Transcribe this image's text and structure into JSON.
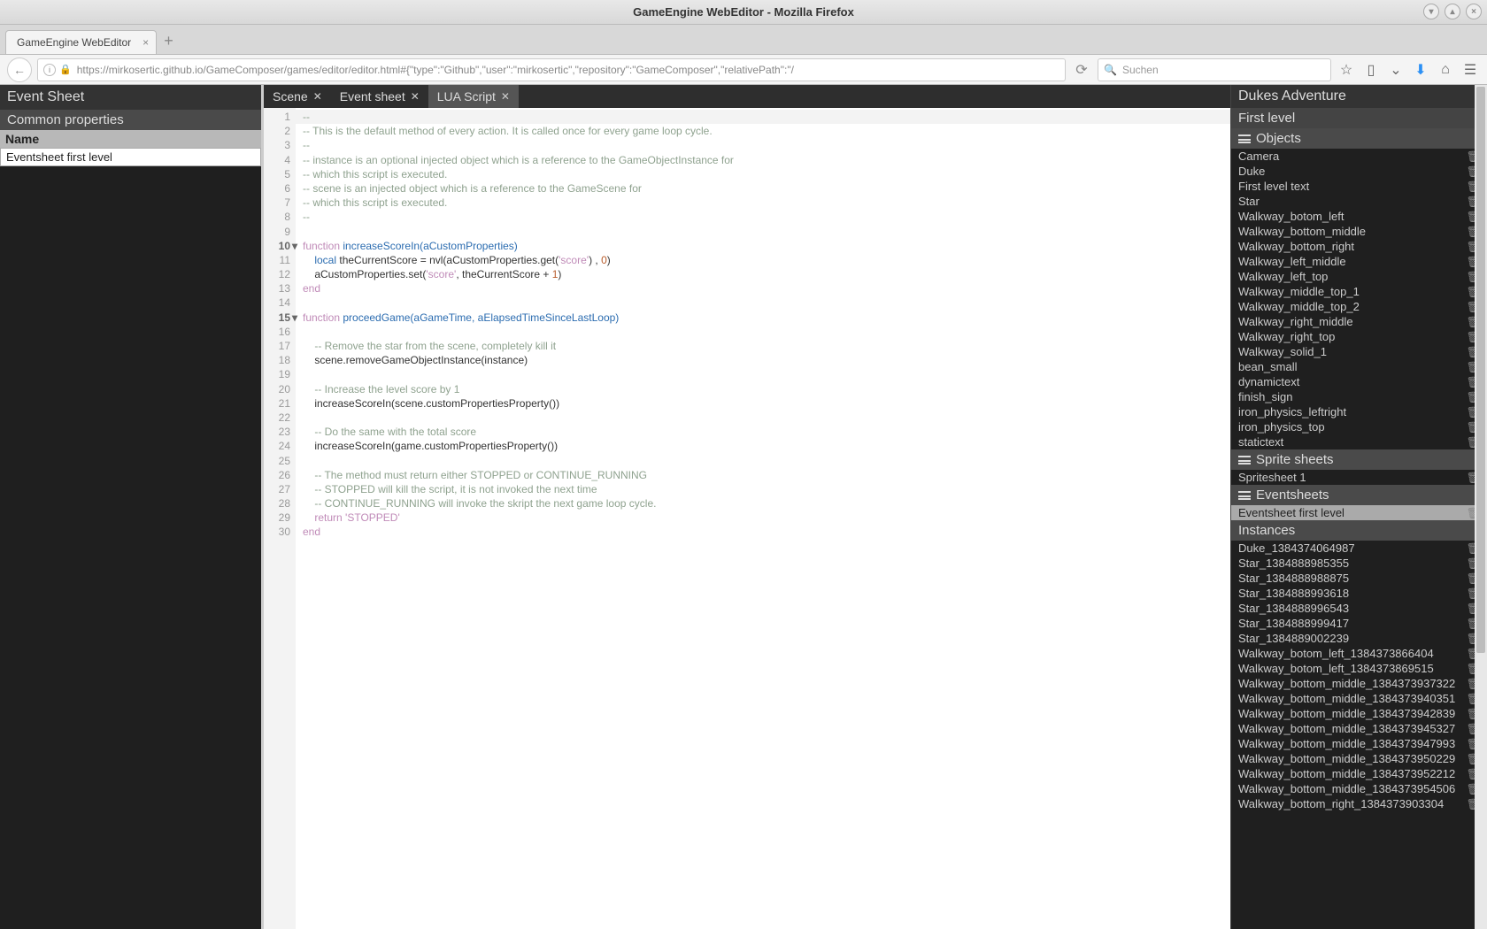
{
  "window": {
    "title": "GameEngine WebEditor - Mozilla Firefox"
  },
  "browser": {
    "tab": "GameEngine WebEditor",
    "url": "https://mirkosertic.github.io/GameComposer/games/editor/editor.html#{\"type\":\"Github\",\"user\":\"mirkosertic\",\"repository\":\"GameComposer\",\"relativePath\":\"/",
    "searchPlaceholder": "Suchen"
  },
  "left": {
    "title": "Event Sheet",
    "section": "Common properties",
    "propLabel": "Name",
    "propValue": "Eventsheet first level"
  },
  "tabs": [
    {
      "label": "Scene",
      "closable": true,
      "active": false
    },
    {
      "label": "Event sheet",
      "closable": true,
      "active": false
    },
    {
      "label": "LUA Script",
      "closable": true,
      "active": true
    }
  ],
  "code": [
    {
      "n": 1,
      "hl": true,
      "seg": [
        {
          "t": "--",
          "c": "c-comment"
        }
      ]
    },
    {
      "n": 2,
      "seg": [
        {
          "t": "-- This is the default method of every action. It is called once for every game loop cycle.",
          "c": "c-comment"
        }
      ]
    },
    {
      "n": 3,
      "seg": [
        {
          "t": "--",
          "c": "c-comment"
        }
      ]
    },
    {
      "n": 4,
      "seg": [
        {
          "t": "-- instance is an optional injected object which is a reference to the GameObjectInstance for",
          "c": "c-comment"
        }
      ]
    },
    {
      "n": 5,
      "seg": [
        {
          "t": "-- which this script is executed.",
          "c": "c-comment"
        }
      ]
    },
    {
      "n": 6,
      "seg": [
        {
          "t": "-- scene is an injected object which is a reference to the GameScene for",
          "c": "c-comment"
        }
      ]
    },
    {
      "n": 7,
      "seg": [
        {
          "t": "-- which this script is executed.",
          "c": "c-comment"
        }
      ]
    },
    {
      "n": 8,
      "seg": [
        {
          "t": "--",
          "c": "c-comment"
        }
      ]
    },
    {
      "n": 9,
      "seg": [
        {
          "t": "",
          "c": ""
        }
      ]
    },
    {
      "n": 10,
      "break": true,
      "seg": [
        {
          "t": "function",
          "c": "c-kw"
        },
        {
          "t": " increaseScoreIn(aCustomProperties)",
          "c": "c-fn"
        }
      ]
    },
    {
      "n": 11,
      "seg": [
        {
          "t": "    ",
          "c": ""
        },
        {
          "t": "local",
          "c": "c-local"
        },
        {
          "t": " theCurrentScore = nvl(aCustomProperties.get(",
          "c": ""
        },
        {
          "t": "'score'",
          "c": "c-str"
        },
        {
          "t": ") , ",
          "c": ""
        },
        {
          "t": "0",
          "c": "c-num"
        },
        {
          "t": ")",
          "c": ""
        }
      ]
    },
    {
      "n": 12,
      "seg": [
        {
          "t": "    aCustomProperties.set(",
          "c": ""
        },
        {
          "t": "'score'",
          "c": "c-str"
        },
        {
          "t": ", theCurrentScore + ",
          "c": ""
        },
        {
          "t": "1",
          "c": "c-num"
        },
        {
          "t": ")",
          "c": ""
        }
      ]
    },
    {
      "n": 13,
      "seg": [
        {
          "t": "end",
          "c": "c-kw"
        }
      ]
    },
    {
      "n": 14,
      "seg": [
        {
          "t": "",
          "c": ""
        }
      ]
    },
    {
      "n": 15,
      "break": true,
      "seg": [
        {
          "t": "function",
          "c": "c-kw"
        },
        {
          "t": " proceedGame(aGameTime, aElapsedTimeSinceLastLoop)",
          "c": "c-fn"
        }
      ]
    },
    {
      "n": 16,
      "seg": [
        {
          "t": "",
          "c": ""
        }
      ]
    },
    {
      "n": 17,
      "seg": [
        {
          "t": "    ",
          "c": ""
        },
        {
          "t": "-- Remove the star from the scene, completely kill it",
          "c": "c-comment"
        }
      ]
    },
    {
      "n": 18,
      "seg": [
        {
          "t": "    scene.removeGameObjectInstance(instance)",
          "c": ""
        }
      ]
    },
    {
      "n": 19,
      "seg": [
        {
          "t": "",
          "c": ""
        }
      ]
    },
    {
      "n": 20,
      "seg": [
        {
          "t": "    ",
          "c": ""
        },
        {
          "t": "-- Increase the level score by 1",
          "c": "c-comment"
        }
      ]
    },
    {
      "n": 21,
      "seg": [
        {
          "t": "    increaseScoreIn(scene.customPropertiesProperty())",
          "c": ""
        }
      ]
    },
    {
      "n": 22,
      "seg": [
        {
          "t": "",
          "c": ""
        }
      ]
    },
    {
      "n": 23,
      "seg": [
        {
          "t": "    ",
          "c": ""
        },
        {
          "t": "-- Do the same with the total score",
          "c": "c-comment"
        }
      ]
    },
    {
      "n": 24,
      "seg": [
        {
          "t": "    increaseScoreIn(game.customPropertiesProperty())",
          "c": ""
        }
      ]
    },
    {
      "n": 25,
      "seg": [
        {
          "t": "",
          "c": ""
        }
      ]
    },
    {
      "n": 26,
      "seg": [
        {
          "t": "    ",
          "c": ""
        },
        {
          "t": "-- The method must return either STOPPED or CONTINUE_RUNNING",
          "c": "c-comment"
        }
      ]
    },
    {
      "n": 27,
      "seg": [
        {
          "t": "    ",
          "c": ""
        },
        {
          "t": "-- STOPPED will kill the script, it is not invoked the next time",
          "c": "c-comment"
        }
      ]
    },
    {
      "n": 28,
      "seg": [
        {
          "t": "    ",
          "c": ""
        },
        {
          "t": "-- CONTINUE_RUNNING will invoke the skript the next game loop cycle.",
          "c": "c-comment"
        }
      ]
    },
    {
      "n": 29,
      "seg": [
        {
          "t": "    ",
          "c": ""
        },
        {
          "t": "return",
          "c": "c-kw"
        },
        {
          "t": " ",
          "c": ""
        },
        {
          "t": "'STOPPED'",
          "c": "c-str"
        }
      ]
    },
    {
      "n": 30,
      "seg": [
        {
          "t": "end",
          "c": "c-kw"
        }
      ]
    }
  ],
  "right": {
    "title": "Dukes Adventure",
    "level": "First level",
    "objectsLabel": "Objects",
    "objects": [
      "Camera",
      "Duke",
      "First level text",
      "Star",
      "Walkway_botom_left",
      "Walkway_bottom_middle",
      "Walkway_bottom_right",
      "Walkway_left_middle",
      "Walkway_left_top",
      "Walkway_middle_top_1",
      "Walkway_middle_top_2",
      "Walkway_right_middle",
      "Walkway_right_top",
      "Walkway_solid_1",
      "bean_small",
      "dynamictext",
      "finish_sign",
      "iron_physics_leftright",
      "iron_physics_top",
      "statictext"
    ],
    "spritesLabel": "Sprite sheets",
    "sprites": [
      "Spritesheet 1"
    ],
    "eventsheetsLabel": "Eventsheets",
    "eventsheets": [
      {
        "label": "Eventsheet first level",
        "sel": true
      }
    ],
    "instancesLabel": "Instances",
    "instances": [
      "Duke_1384374064987",
      "Star_1384888985355",
      "Star_1384888988875",
      "Star_1384888993618",
      "Star_1384888996543",
      "Star_1384888999417",
      "Star_1384889002239",
      "Walkway_botom_left_1384373866404",
      "Walkway_botom_left_1384373869515",
      "Walkway_bottom_middle_1384373937322",
      "Walkway_bottom_middle_1384373940351",
      "Walkway_bottom_middle_1384373942839",
      "Walkway_bottom_middle_1384373945327",
      "Walkway_bottom_middle_1384373947993",
      "Walkway_bottom_middle_1384373950229",
      "Walkway_bottom_middle_1384373952212",
      "Walkway_bottom_middle_1384373954506",
      "Walkway_bottom_right_1384373903304"
    ]
  }
}
